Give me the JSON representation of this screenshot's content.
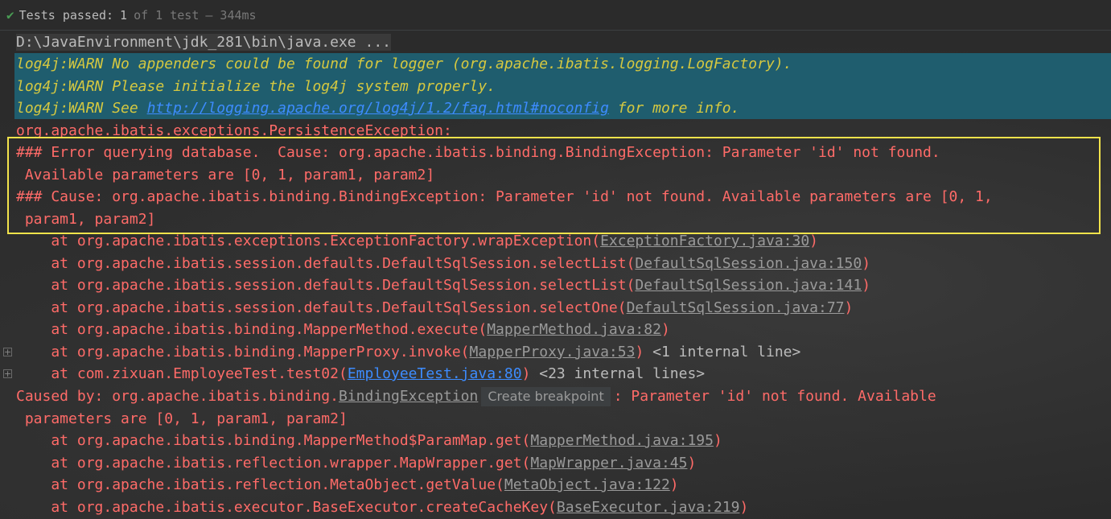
{
  "status": {
    "label": "Tests passed:",
    "passed": "1",
    "total_text": "of 1 test",
    "duration": "– 344ms"
  },
  "console": {
    "command": "D:\\JavaEnvironment\\jdk_281\\bin\\java.exe ...",
    "warn1": "log4j:WARN No appenders could be found for logger (org.apache.ibatis.logging.LogFactory).",
    "warn2": "log4j:WARN Please initialize the log4j system properly.",
    "warn3_pre": "log4j:WARN See ",
    "warn3_link": "http://logging.apache.org/log4j/1.2/faq.html#noconfig",
    "warn3_post": " for more info.",
    "exception": "org.apache.ibatis.exceptions.PersistenceException: ",
    "err1": "### Error querying database.  Cause: org.apache.ibatis.binding.BindingException: Parameter 'id' not found.",
    "err1b": " Available parameters are [0, 1, param1, param2]",
    "err2": "### Cause: org.apache.ibatis.binding.BindingException: Parameter 'id' not found. Available parameters are [0, 1,",
    "err2b": " param1, param2]",
    "stack1": [
      {
        "method": "    at org.apache.ibatis.exceptions.ExceptionFactory.wrapException(",
        "file": "ExceptionFactory.java:30",
        "end": ")",
        "extra": ""
      },
      {
        "method": "    at org.apache.ibatis.session.defaults.DefaultSqlSession.selectList(",
        "file": "DefaultSqlSession.java:150",
        "end": ")",
        "extra": ""
      },
      {
        "method": "    at org.apache.ibatis.session.defaults.DefaultSqlSession.selectList(",
        "file": "DefaultSqlSession.java:141",
        "end": ")",
        "extra": ""
      },
      {
        "method": "    at org.apache.ibatis.session.defaults.DefaultSqlSession.selectOne(",
        "file": "DefaultSqlSession.java:77",
        "end": ")",
        "extra": ""
      },
      {
        "method": "    at org.apache.ibatis.binding.MapperMethod.execute(",
        "file": "MapperMethod.java:82",
        "end": ")",
        "extra": ""
      },
      {
        "method": "    at org.apache.ibatis.binding.MapperProxy.invoke(",
        "file": "MapperProxy.java:53",
        "end": ")",
        "extra": " <1 internal line>"
      },
      {
        "method": "    at com.zixuan.EmployeeTest.test02(",
        "file": "EmployeeTest.java:80",
        "end": ")",
        "extra": " <23 internal lines>"
      }
    ],
    "caused_pre": "Caused by: org.apache.ibatis.binding.",
    "caused_class": "BindingException",
    "tooltip": "Create breakpoint",
    "caused_post": ": Parameter 'id' not found. Available",
    "caused_cont": " parameters are [0, 1, param1, param2]",
    "stack2": [
      {
        "method": "    at org.apache.ibatis.binding.MapperMethod$ParamMap.get(",
        "file": "MapperMethod.java:195",
        "end": ")"
      },
      {
        "method": "    at org.apache.ibatis.reflection.wrapper.MapWrapper.get(",
        "file": "MapWrapper.java:45",
        "end": ")"
      },
      {
        "method": "    at org.apache.ibatis.reflection.MetaObject.getValue(",
        "file": "MetaObject.java:122",
        "end": ")"
      },
      {
        "method": "    at org.apache.ibatis.executor.BaseExecutor.createCacheKey(",
        "file": "BaseExecutor.java:219",
        "end": ")"
      }
    ]
  },
  "colors": {
    "error": "#ff6b68",
    "warn": "#d5c840",
    "link": "#3d8cff",
    "highlight": "#f2e34b"
  }
}
